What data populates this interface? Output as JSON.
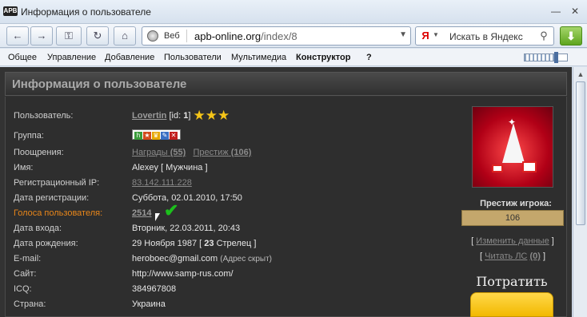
{
  "window": {
    "title": "Информация о пользователе",
    "logo": "APB"
  },
  "nav": {
    "back_icon": "←",
    "forward_icon": "→",
    "home_icon": "⌂",
    "web_label": "Веб",
    "url_host": "apb-online.org",
    "url_path": "/index/8",
    "search_placeholder": "Искать в Яндекс",
    "search_engine": "Я"
  },
  "menu": {
    "items": [
      "Общее",
      "Управление",
      "Добавление",
      "Пользователи",
      "Мультимедиа",
      "Конструктор",
      "?"
    ]
  },
  "panel": {
    "title": "Информация о пользователе"
  },
  "profile": {
    "user_label": "Пользователь:",
    "username": "Lovertin",
    "id_prefix": "[id: ",
    "id": "1",
    "id_suffix": "]",
    "group_label": "Группа:",
    "awards_label": "Поощрения:",
    "awards_link": "Награды",
    "awards_count": "(55)",
    "prestige_link": "Престиж",
    "prestige_count": "(106)",
    "name_label": "Имя:",
    "name_value": "Alexey [ Мужчина ]",
    "reg_ip_label": "Регистрационный IP:",
    "reg_ip_value": "83.142.111.228",
    "reg_date_label": "Дата регистрации:",
    "reg_date_value": "Суббота, 02.01.2010, 17:50",
    "votes_label": "Голоса пользователя:",
    "votes_value": "2514",
    "login_label": "Дата входа:",
    "login_value": "Вторник, 22.03.2011, 20:43",
    "birth_label": "Дата рождения:",
    "birth_value_a": "29 Ноября 1987 [ ",
    "birth_value_b": "23",
    "birth_value_c": " Стрелец ]",
    "email_label": "E-mail:",
    "email_value": "heroboec@gmail.com",
    "email_note": "(Адрес скрыт)",
    "site_label": "Сайт:",
    "site_value": "http://www.samp-rus.com/",
    "icq_label": "ICQ:",
    "icq_value": "384967808",
    "country_label": "Страна:",
    "country_value": "Украина"
  },
  "side": {
    "prestige_label": "Престиж игрока:",
    "prestige_value": "106",
    "edit_link": "Изменить данные",
    "pm_link": "Читать ЛС",
    "pm_count": "(0)",
    "spend_title": "Потратить"
  },
  "colors": {
    "highlight": "#e8861a",
    "stars": "#f5c518",
    "prestige_bar": "#c4a76c"
  }
}
